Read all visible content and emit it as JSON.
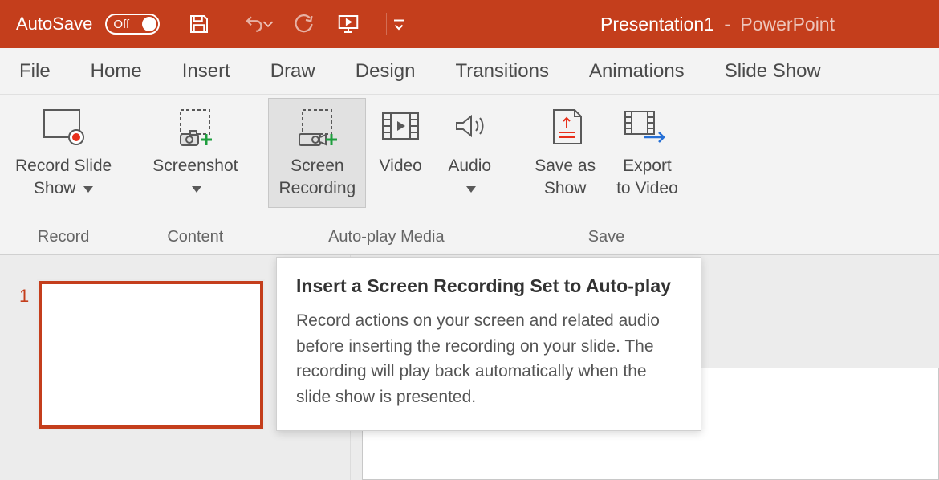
{
  "titlebar": {
    "autosave_label": "AutoSave",
    "autosave_state": "Off",
    "filename": "Presentation1",
    "dash": "-",
    "app": "PowerPoint"
  },
  "tabs": {
    "file": "File",
    "home": "Home",
    "insert": "Insert",
    "draw": "Draw",
    "design": "Design",
    "transitions": "Transitions",
    "animations": "Animations",
    "slideshow": "Slide Show"
  },
  "ribbon": {
    "record_slide_show": "Record Slide\nShow",
    "screenshot": "Screenshot",
    "screen_recording": "Screen\nRecording",
    "video": "Video",
    "audio": "Audio",
    "save_as_show": "Save as\nShow",
    "export_to_video": "Export\nto Video",
    "group_record": "Record",
    "group_content": "Content",
    "group_autoplay": "Auto-play Media",
    "group_save": "Save"
  },
  "slide": {
    "number": "1"
  },
  "tooltip": {
    "title": "Insert a Screen Recording Set to Auto-play",
    "body": "Record actions on your screen and related audio before inserting the recording on your slide. The recording will play back automatically when the slide show is presented."
  }
}
